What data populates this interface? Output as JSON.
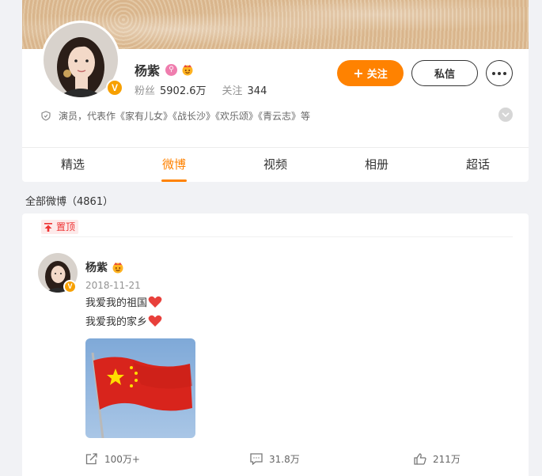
{
  "profile": {
    "name": "杨紫",
    "verified_mark": "V",
    "badges": [
      "pink-medal-icon",
      "crown-emoji-icon"
    ],
    "followers_label": "粉丝",
    "followers_count": "5902.6万",
    "following_label": "关注",
    "following_count": "344",
    "follow_button": "关注",
    "message_button": "私信",
    "description": "演员，代表作《家有儿女》《战长沙》《欢乐颂》《青云志》等"
  },
  "tabs": [
    {
      "label": "精选"
    },
    {
      "label": "微博"
    },
    {
      "label": "视频"
    },
    {
      "label": "相册"
    },
    {
      "label": "超话"
    }
  ],
  "active_tab": "微博",
  "feed": {
    "all_label": "全部微博（4861）"
  },
  "post": {
    "pinned_label": "置顶",
    "author": "杨紫",
    "date": "2018-11-21",
    "lines": [
      "我爱我的祖国",
      "我爱我的家乡"
    ],
    "image_subject": "china-flag-image",
    "shares": "100万+",
    "comments": "31.8万",
    "likes": "211万"
  },
  "colors": {
    "accent": "#ff8200",
    "pinned": "#e33333",
    "verified": "#f7a000",
    "background": "#f1f2f5"
  }
}
